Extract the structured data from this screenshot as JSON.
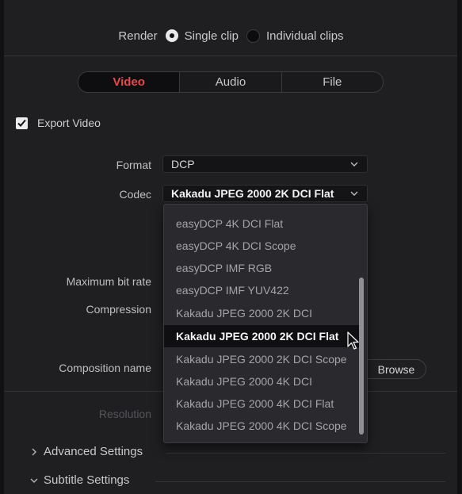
{
  "render": {
    "label": "Render",
    "options": [
      {
        "label": "Single clip",
        "selected": true
      },
      {
        "label": "Individual clips",
        "selected": false
      }
    ]
  },
  "tabs": [
    {
      "label": "Video",
      "active": true
    },
    {
      "label": "Audio",
      "active": false
    },
    {
      "label": "File",
      "active": false
    }
  ],
  "export_video": {
    "label": "Export Video",
    "checked": true
  },
  "form": {
    "format_label": "Format",
    "format_value": "DCP",
    "codec_label": "Codec",
    "codec_value": "Kakadu JPEG 2000 2K DCI Flat",
    "max_bitrate_label": "Maximum bit rate",
    "compression_label": "Compression",
    "composition_label": "Composition name",
    "browse_label": "Browse",
    "resolution_label": "Resolution"
  },
  "codec_dropdown": {
    "items": [
      "easyDCP 4K DCI Flat",
      "easyDCP 4K DCI Scope",
      "easyDCP IMF RGB",
      "easyDCP IMF YUV422",
      "Kakadu JPEG 2000 2K DCI",
      "Kakadu JPEG 2000 2K DCI Flat",
      "Kakadu JPEG 2000 2K DCI Scope",
      "Kakadu JPEG 2000 4K DCI",
      "Kakadu JPEG 2000 4K DCI Flat",
      "Kakadu JPEG 2000 4K DCI Scope"
    ],
    "selected_index": 5
  },
  "sections": {
    "advanced": "Advanced Settings",
    "subtitle": "Subtitle Settings"
  },
  "colors": {
    "accent": "#e8484a",
    "background": "#1f1f22"
  }
}
